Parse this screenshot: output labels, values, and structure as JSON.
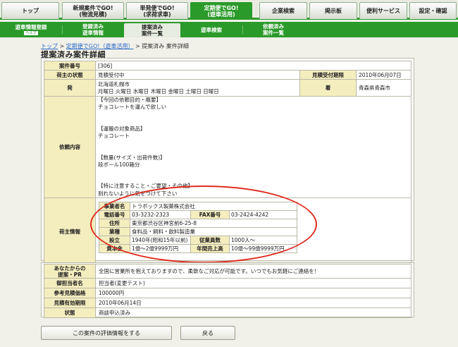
{
  "topnav": {
    "top": "トップ",
    "tab1_l1": "新規案件でGO!",
    "tab1_l2": "(物流見積)",
    "tab2_l1": "単発便でGO!",
    "tab2_l2": "(求荷求車)",
    "tab3_l1": "定期便でGO!",
    "tab3_l2": "(遊車活用)",
    "company_search": "企業検索",
    "bbs": "掲示板",
    "services": "便利サービス",
    "settings": "設定・確認"
  },
  "subnav": {
    "register": "遊車情報登録",
    "help": "ヘルプ",
    "registered_l1": "登録済み",
    "registered_l2": "遊車情報",
    "proposed_l1": "提案済み",
    "proposed_l2": "案件一覧",
    "search": "遊車検索",
    "requested_l1": "依頼済み",
    "requested_l2": "案件一覧"
  },
  "breadcrumb": {
    "top": "トップ",
    "sep1": " > ",
    "regular": "定期便でGO!（遊車活用）",
    "sep2": " > ",
    "current": "提案済み 案件詳細"
  },
  "page_title": "提案済み案件詳細",
  "detail": {
    "case_no_label": "案件番号",
    "case_no": "[306]",
    "status_label": "荷主の状態",
    "status": "見積受付中",
    "deadline_label": "見積受付期限",
    "deadline": "2010年06月07日",
    "origin_label": "発",
    "origin_city": "北海道札幌市",
    "origin_days": "月曜日 火曜日 水曜日 木曜日 金曜日 土曜日 日曜日",
    "dest_label": "着",
    "dest": "青森県青森市",
    "request_label": "依頼内容",
    "request_lines": [
      "【今回の依頼目的・概要】",
      "チョコレートを運んで欲しい",
      "",
      "",
      "【運搬の対象商品】",
      "チョコレート",
      "",
      "",
      "【数量(サイズ・出荷件数)】",
      "段ボール100箱分",
      "",
      "",
      "【特に注意すること・ご要望・その他】",
      "割れないように気をつけて下さい"
    ],
    "shipper_label": "荷主情報",
    "shipper": {
      "name_label": "事業者名",
      "name": "トラボックス製菓株式会社",
      "tel_label": "電話番号",
      "tel": "03-3232-2323",
      "fax_label": "FAX番号",
      "fax": "03-2424-4242",
      "addr_label": "住所",
      "addr": "東京都渋谷区神宮前6-25-8",
      "industry_label": "業種",
      "industry": "食料品・飼料・飲料製造業",
      "founded_label": "設立",
      "founded": "1940年(昭和15年以前)",
      "employees_label": "従業員数",
      "employees": "1000人〜",
      "capital_label": "資本金",
      "capital": "1億〜2億9999万円",
      "sales_label": "年間売上高",
      "sales": "10億〜99億9999万円"
    }
  },
  "proposal": {
    "pr_label_l1": "あなたからの",
    "pr_label_l2": "提案・PR",
    "pr": "全国に営業所を抱えておりますので、柔軟なご対応が可能です。いつでもお気軽にご連絡を！",
    "rep_label": "御担当者名",
    "rep": "担当者(変更テスト)",
    "price_label": "参考見積価格",
    "price": "100000円",
    "valid_label": "見積有効期限",
    "valid": "2010年06月14日",
    "state_label": "状態",
    "state": "商談申込済み"
  },
  "buttons": {
    "evaluate": "この案件の評価情報をする",
    "back": "戻る"
  },
  "colors": {
    "accent": "#2a9a2a",
    "label_bg": "#f4edbe",
    "highlight": "#e12b1f"
  }
}
